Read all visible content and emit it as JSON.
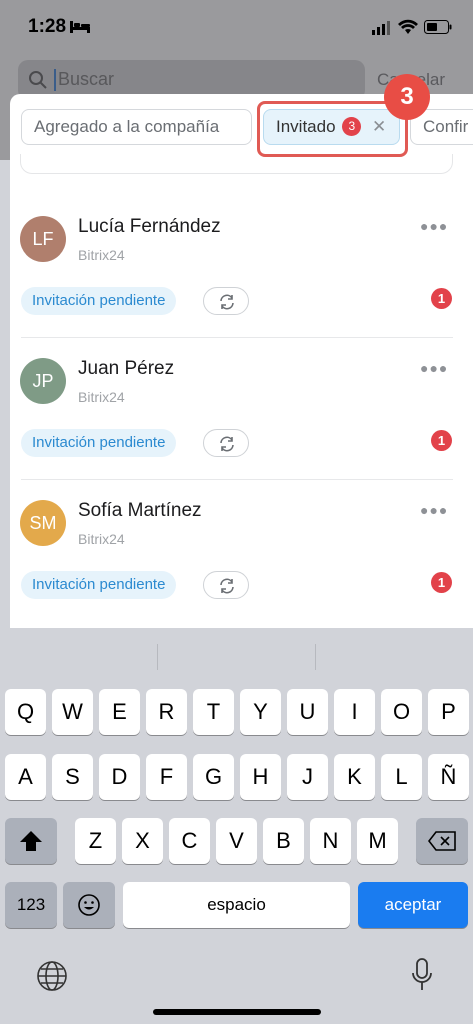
{
  "status_bar": {
    "time": "1:28"
  },
  "search": {
    "placeholder": "Buscar",
    "cancel_label": "Cancelar"
  },
  "chips": [
    {
      "label": "Agregado a la compañía"
    },
    {
      "label": "Invitado",
      "count": "3"
    },
    {
      "label": "Confir"
    }
  ],
  "callout": {
    "number": "3"
  },
  "users": [
    {
      "initials": "LF",
      "name": "Lucía Fernández",
      "company": "Bitrix24",
      "status": "Invitación pendiente",
      "badge": "1",
      "avatar_color": "#b07f6d"
    },
    {
      "initials": "JP",
      "name": "Juan Pérez",
      "company": "Bitrix24",
      "status": "Invitación pendiente",
      "badge": "1",
      "avatar_color": "#7f9b86"
    },
    {
      "initials": "SM",
      "name": "Sofía Martínez",
      "company": "Bitrix24",
      "status": "Invitación pendiente",
      "badge": "1",
      "avatar_color": "#e3a94b"
    }
  ],
  "keyboard": {
    "row1": [
      "Q",
      "W",
      "E",
      "R",
      "T",
      "Y",
      "U",
      "I",
      "O",
      "P"
    ],
    "row2": [
      "A",
      "S",
      "D",
      "F",
      "G",
      "H",
      "J",
      "K",
      "L",
      "Ñ"
    ],
    "row3": [
      "Z",
      "X",
      "C",
      "V",
      "B",
      "N",
      "M"
    ],
    "numbers_key": "123",
    "space_key": "espacio",
    "return_key": "aceptar"
  },
  "colors": {
    "accent": "#2b8ad0",
    "badge": "#e2424a",
    "return_key": "#1a7cf0"
  }
}
